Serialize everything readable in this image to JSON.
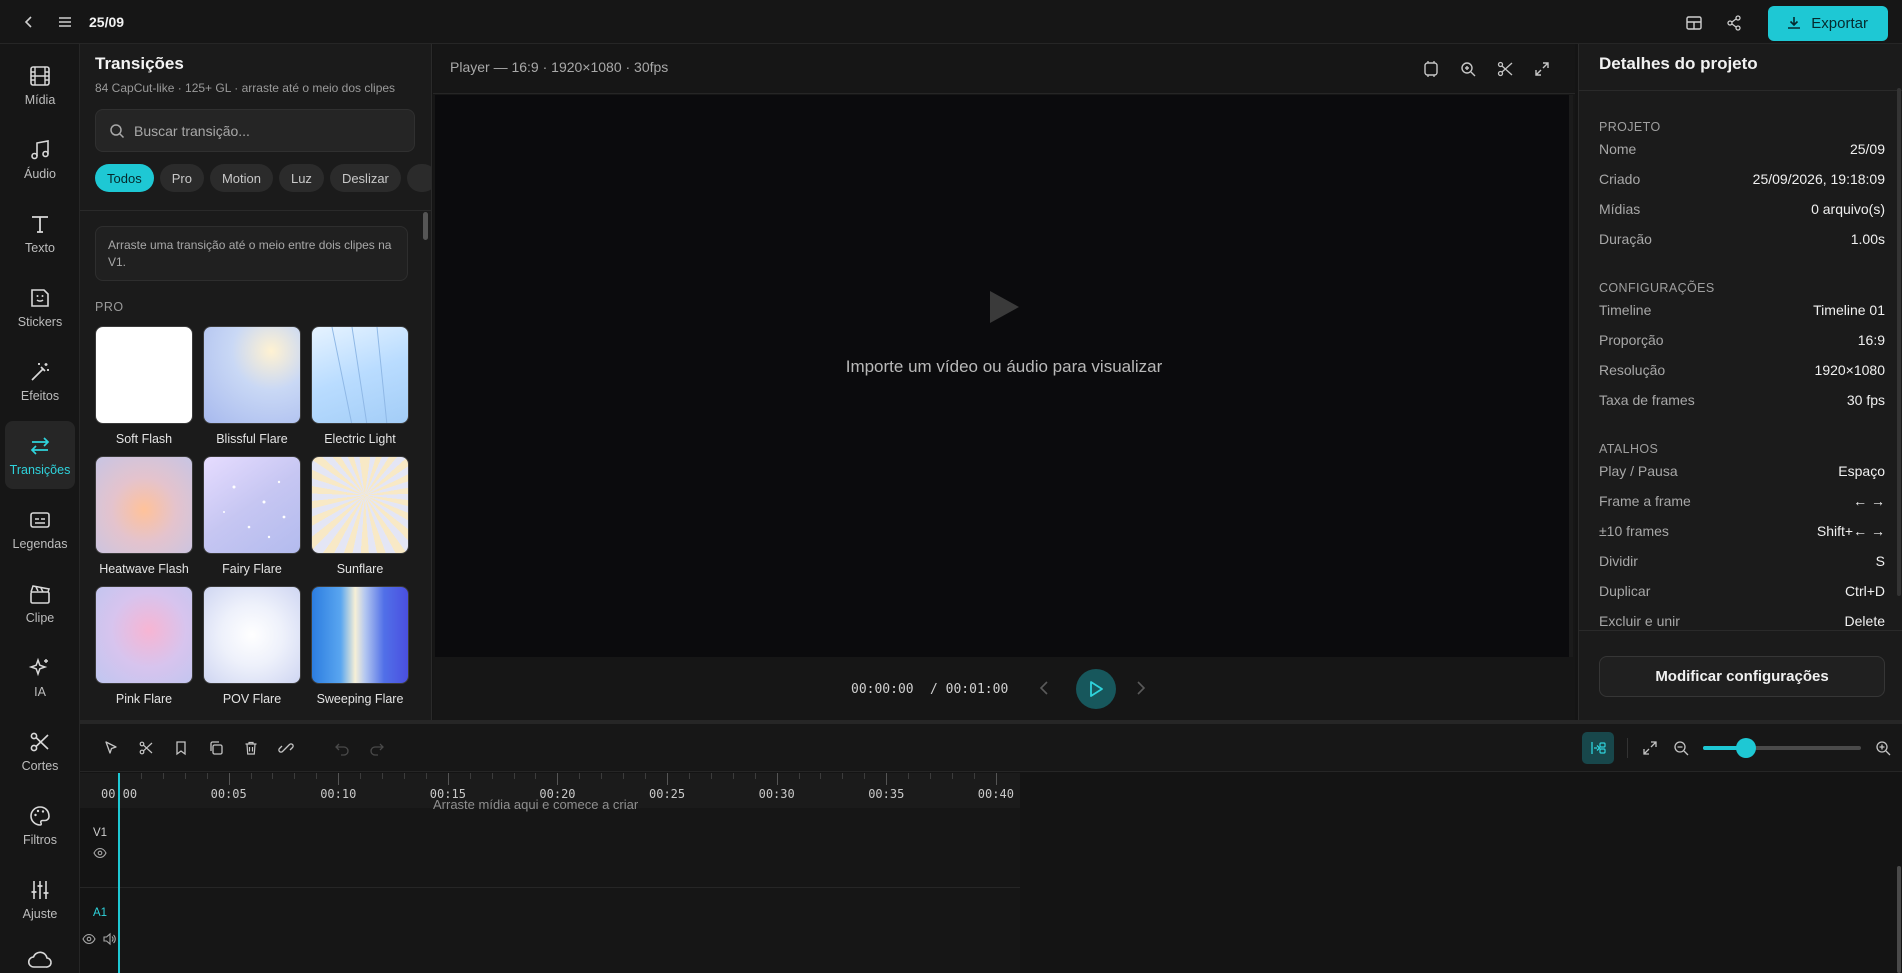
{
  "header": {
    "title": "25/09",
    "export_label": "Exportar"
  },
  "rail": {
    "items": [
      {
        "label": "Mídia",
        "icon": "film-icon"
      },
      {
        "label": "Áudio",
        "icon": "music-icon"
      },
      {
        "label": "Texto",
        "icon": "text-icon"
      },
      {
        "label": "Stickers",
        "icon": "sticker-icon"
      },
      {
        "label": "Efeitos",
        "icon": "magic-wand-icon"
      },
      {
        "label": "Transições",
        "icon": "arrows-swap-icon"
      },
      {
        "label": "Legendas",
        "icon": "captions-icon"
      },
      {
        "label": "Clipe",
        "icon": "clapperboard-icon"
      },
      {
        "label": "IA",
        "icon": "sparkles-icon"
      },
      {
        "label": "Cortes",
        "icon": "scissors-icon"
      },
      {
        "label": "Filtros",
        "icon": "palette-icon"
      },
      {
        "label": "Ajuste",
        "icon": "sliders-icon"
      }
    ],
    "active": "Transições"
  },
  "transitions": {
    "title": "Transições",
    "subtitle": "84 CapCut-like · 125+ GL · arraste até o meio dos clipes",
    "search_placeholder": "Buscar transição...",
    "chips": [
      "Todos",
      "Pro",
      "Motion",
      "Luz",
      "Deslizar"
    ],
    "active_chip": "Todos",
    "hint": "Arraste uma transição até o meio entre dois clipes na V1.",
    "section": "PRO",
    "tiles": [
      "Soft Flash",
      "Blissful Flare",
      "Electric Light",
      "Heatwave Flash",
      "Fairy Flare",
      "Sunflare",
      "Pink Flare",
      "POV Flare",
      "Sweeping Flare"
    ]
  },
  "player": {
    "label": "Player — 16:9 · 1920×1080 · 30fps",
    "empty_message": "Importe um vídeo ou áudio para visualizar",
    "current_time": "00:00:00",
    "total_time": "/ 00:01:00"
  },
  "details": {
    "title": "Detalhes do projeto",
    "sections": [
      {
        "heading": "PROJETO",
        "rows": [
          {
            "k": "Nome",
            "v": "25/09"
          },
          {
            "k": "Criado",
            "v": "25/09/2026, 19:18:09"
          },
          {
            "k": "Mídias",
            "v": "0 arquivo(s)"
          },
          {
            "k": "Duração",
            "v": "1.00s"
          }
        ]
      },
      {
        "heading": "CONFIGURAÇÕES",
        "rows": [
          {
            "k": "Timeline",
            "v": "Timeline 01"
          },
          {
            "k": "Proporção",
            "v": "16:9"
          },
          {
            "k": "Resolução",
            "v": "1920×1080"
          },
          {
            "k": "Taxa de frames",
            "v": "30 fps"
          }
        ]
      },
      {
        "heading": "ATALHOS",
        "rows": [
          {
            "k": "Play / Pausa",
            "v": "Espaço"
          },
          {
            "k": "Frame a frame",
            "v": "← →"
          },
          {
            "k": "±10 frames",
            "v": "Shift+← →"
          },
          {
            "k": "Dividir",
            "v": "S"
          },
          {
            "k": "Duplicar",
            "v": "Ctrl+D"
          },
          {
            "k": "Excluir e unir",
            "v": "Delete"
          }
        ]
      }
    ],
    "button_label": "Modificar configurações"
  },
  "timeline": {
    "ruler_labels": [
      "00:00",
      "00:05",
      "00:10",
      "00:15",
      "00:20",
      "00:25",
      "00:30",
      "00:35",
      "00:40"
    ],
    "tracks": [
      "V1",
      "A1"
    ],
    "drop_hint": "Arraste mídia aqui e comece a criar",
    "zoom_level": 0.27
  },
  "colors": {
    "accent": "#1ec8d4",
    "background": "#141414",
    "panel": "#1b1b1b"
  }
}
